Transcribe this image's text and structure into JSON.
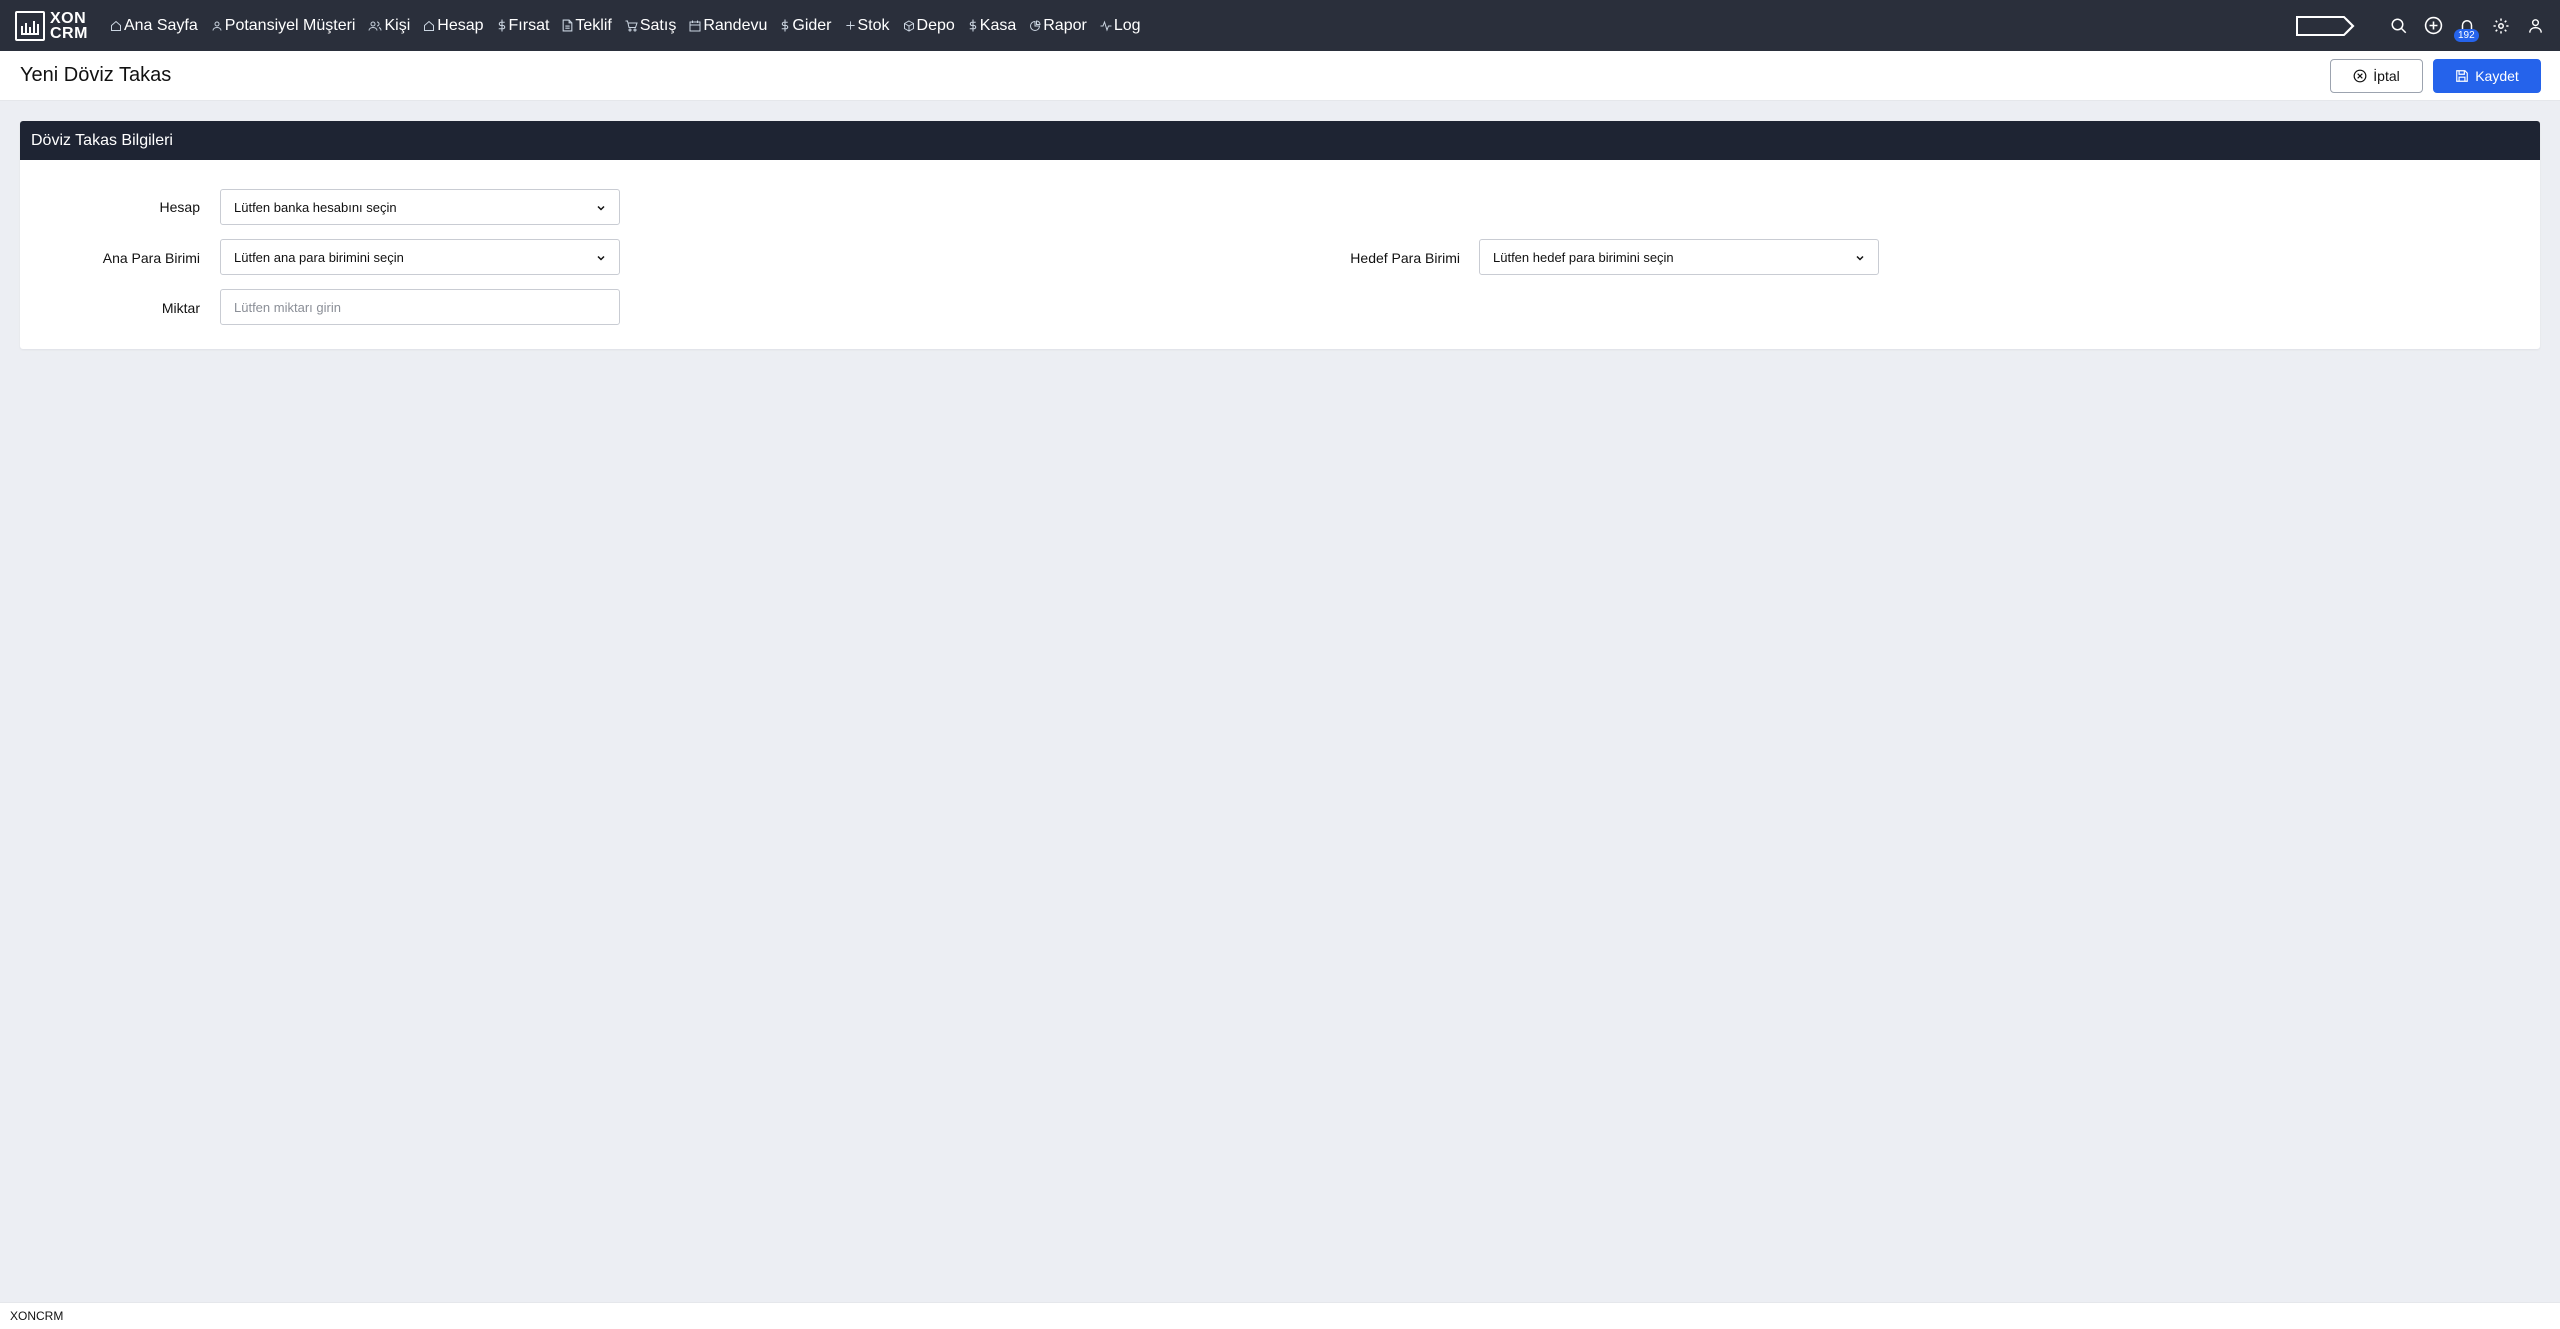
{
  "app": {
    "logo_line1": "XON",
    "logo_line2": "CRM",
    "footer_text": "XONCRM"
  },
  "nav": {
    "items": [
      {
        "label": "Ana Sayfa",
        "icon": "home-icon"
      },
      {
        "label": "Potansiyel Müşteri",
        "icon": "user-icon"
      },
      {
        "label": "Kişi",
        "icon": "users-icon"
      },
      {
        "label": "Hesap",
        "icon": "home-icon"
      },
      {
        "label": "Fırsat",
        "icon": "dollar-icon"
      },
      {
        "label": "Teklif",
        "icon": "file-icon"
      },
      {
        "label": "Satış",
        "icon": "cart-icon"
      },
      {
        "label": "Randevu",
        "icon": "calendar-icon"
      },
      {
        "label": "Gider",
        "icon": "dollar-icon"
      },
      {
        "label": "Stok",
        "icon": "plus-icon"
      },
      {
        "label": "Depo",
        "icon": "box-icon"
      },
      {
        "label": "Kasa",
        "icon": "dollar-icon"
      },
      {
        "label": "Rapor",
        "icon": "chart-pie-icon"
      },
      {
        "label": "Log",
        "icon": "activity-icon"
      }
    ],
    "notification_count": "192"
  },
  "header": {
    "title": "Yeni Döviz Takas",
    "cancel_label": "İptal",
    "save_label": "Kaydet"
  },
  "form": {
    "section_title": "Döviz Takas Bilgileri",
    "account_label": "Hesap",
    "account_value": "Lütfen banka hesabını seçin",
    "base_currency_label": "Ana Para Birimi",
    "base_currency_value": "Lütfen ana para birimini seçin",
    "target_currency_label": "Hedef Para Birimi",
    "target_currency_value": "Lütfen hedef para birimini seçin",
    "amount_label": "Miktar",
    "amount_placeholder": "Lütfen miktarı girin",
    "amount_value": ""
  },
  "colors": {
    "navbar": "#2a2f3b",
    "card_header": "#1e2433",
    "primary": "#2563eb",
    "page_bg": "#eceef3"
  }
}
